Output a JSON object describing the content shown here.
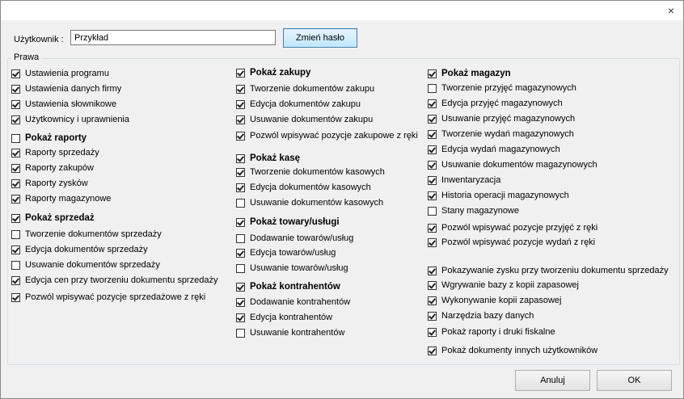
{
  "window": {
    "close_glyph": "×"
  },
  "user": {
    "label": "Użytkownik :",
    "value": "Przykład",
    "change_password_label": "Zmień hasło"
  },
  "group_title": "Prawa",
  "columns": [
    [
      {
        "label": "Ustawienia programu",
        "checked": true,
        "bold": false
      },
      {
        "label": "Ustawienia danych firmy",
        "checked": true,
        "bold": false
      },
      {
        "label": "Ustawienia słownikowe",
        "checked": true,
        "bold": false
      },
      {
        "label": "Użytkownicy i uprawnienia",
        "checked": true,
        "bold": false
      },
      {
        "label": "Pokaż raporty",
        "checked": false,
        "bold": true
      },
      {
        "label": "Raporty sprzedaży",
        "checked": true,
        "bold": false
      },
      {
        "label": "Raporty zakupów",
        "checked": true,
        "bold": false
      },
      {
        "label": "Raporty zysków",
        "checked": true,
        "bold": false
      },
      {
        "label": "Raporty magazynowe",
        "checked": true,
        "bold": false
      },
      {
        "label": "Pokaż sprzedaż",
        "checked": true,
        "bold": true
      },
      {
        "label": "Tworzenie dokumentów sprzedaży",
        "checked": false,
        "bold": false
      },
      {
        "label": "Edycja dokumentów sprzedaży",
        "checked": true,
        "bold": false
      },
      {
        "label": "Usuwanie dokumentów sprzedaży",
        "checked": false,
        "bold": false
      },
      {
        "label": "Edycja cen przy tworzeniu dokumentu sprzedaży",
        "checked": true,
        "bold": false
      },
      {
        "label": "Pozwól wpisywać pozycje sprzedażowe z ręki",
        "checked": true,
        "bold": false
      }
    ],
    [
      {
        "label": "Pokaż zakupy",
        "checked": true,
        "bold": true
      },
      {
        "label": "Tworzenie dokumentów zakupu",
        "checked": true,
        "bold": false
      },
      {
        "label": "Edycja dokumentów zakupu",
        "checked": true,
        "bold": false
      },
      {
        "label": "Usuwanie dokumentów zakupu",
        "checked": true,
        "bold": false
      },
      {
        "label": "Pozwól wpisywać pozycje zakupowe z ręki",
        "checked": true,
        "bold": false
      },
      {
        "label": "Pokaż kasę",
        "checked": true,
        "bold": true
      },
      {
        "label": "Tworzenie dokumentów kasowych",
        "checked": true,
        "bold": false
      },
      {
        "label": "Edycja dokumentów kasowych",
        "checked": true,
        "bold": false
      },
      {
        "label": "Usuwanie dokumentów kasowych",
        "checked": false,
        "bold": false
      },
      {
        "label": "Pokaż towary/usługi",
        "checked": true,
        "bold": true
      },
      {
        "label": "Dodawanie towarów/usług",
        "checked": false,
        "bold": false
      },
      {
        "label": "Edycja towarów/usług",
        "checked": true,
        "bold": false
      },
      {
        "label": "Usuwanie towarów/usług",
        "checked": false,
        "bold": false
      },
      {
        "label": "Pokaż kontrahentów",
        "checked": true,
        "bold": true
      },
      {
        "label": "Dodawanie kontrahentów",
        "checked": true,
        "bold": false
      },
      {
        "label": "Edycja kontrahentów",
        "checked": true,
        "bold": false
      },
      {
        "label": "Usuwanie kontrahentów",
        "checked": false,
        "bold": false
      }
    ],
    [
      {
        "label": "Pokaż magazyn",
        "checked": true,
        "bold": true
      },
      {
        "label": "Tworzenie przyjęć magazynowych",
        "checked": false,
        "bold": false
      },
      {
        "label": "Edycja przyjęć magazynowych",
        "checked": true,
        "bold": false
      },
      {
        "label": "Usuwanie przyjęć magazynowych",
        "checked": true,
        "bold": false
      },
      {
        "label": "Tworzenie wydań magazynowych",
        "checked": true,
        "bold": false
      },
      {
        "label": "Edycja wydań magazynowych",
        "checked": true,
        "bold": false
      },
      {
        "label": "Usuwanie dokumentów magazynowych",
        "checked": true,
        "bold": false
      },
      {
        "label": "Inwentaryzacja",
        "checked": true,
        "bold": false
      },
      {
        "label": "Historia operacji magazynowych",
        "checked": true,
        "bold": false
      },
      {
        "label": "Stany magazynowe",
        "checked": false,
        "bold": false
      },
      {
        "label": "Pozwól wpisywać pozycje przyjęć z ręki",
        "checked": true,
        "bold": false
      },
      {
        "label": "Pozwól wpisywać pozycje wydań z ręki",
        "checked": true,
        "bold": false
      },
      {
        "label": "Pokazywanie zysku przy tworzeniu dokumentu sprzedaży",
        "checked": true,
        "bold": false
      },
      {
        "label": "Wgrywanie bazy z kopii zapasowej",
        "checked": true,
        "bold": false
      },
      {
        "label": "Wykonywanie kopii zapasowej",
        "checked": true,
        "bold": false
      },
      {
        "label": "Narzędzia bazy danych",
        "checked": true,
        "bold": false
      },
      {
        "label": "Pokaż raporty i druki fiskalne",
        "checked": true,
        "bold": false
      },
      {
        "label": "Pokaż dokumenty innych użytkowników",
        "checked": true,
        "bold": false
      }
    ]
  ],
  "footer": {
    "cancel_label": "Anuluj",
    "ok_label": "OK"
  }
}
